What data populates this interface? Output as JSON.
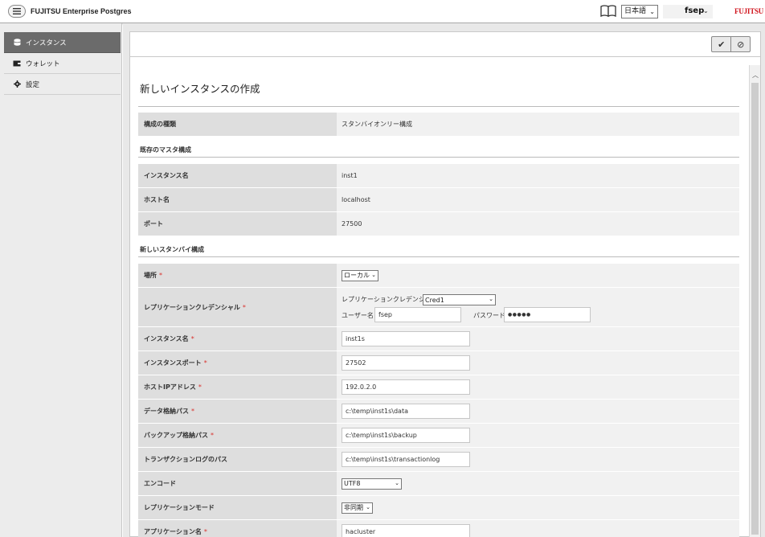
{
  "header": {
    "app_title": "FUJITSU Enterprise Postgres",
    "language": "日本語",
    "user": "fsep",
    "brand": "FUJITSU"
  },
  "sidebar": {
    "items": [
      {
        "label": "インスタンス",
        "icon": "database-icon",
        "active": true
      },
      {
        "label": "ウォレット",
        "icon": "wallet-icon",
        "active": false
      },
      {
        "label": "設定",
        "icon": "gear-icon",
        "active": false
      }
    ]
  },
  "toolbar": {
    "confirm_icon": "✔",
    "cancel_icon": "⊘"
  },
  "page": {
    "title": "新しいインスタンスの作成",
    "config_type_label": "構成の種類",
    "config_type_value": "スタンバイオンリー構成",
    "existing_master_section": "既存のマスタ構成",
    "existing": {
      "instance_name_label": "インスタンス名",
      "instance_name_value": "inst1",
      "host_label": "ホスト名",
      "host_value": "localhost",
      "port_label": "ポート",
      "port_value": "27500"
    },
    "new_standby_section": "新しいスタンバイ構成",
    "form": {
      "location_label": "場所",
      "location_value": "ローカル",
      "credential_label": "レプリケーションクレデンシャル",
      "credential_inline_label": "レプリケーションクレデンシャル",
      "credential_value": "Cred1",
      "username_label": "ユーザー名",
      "username_value": "fsep",
      "password_label": "パスワード",
      "password_value": "●●●●●",
      "instance_name_label": "インスタンス名",
      "instance_name_value": "inst1s",
      "instance_port_label": "インスタンスポート",
      "instance_port_value": "27502",
      "host_ip_label": "ホストIPアドレス",
      "host_ip_value": "192.0.2.0",
      "data_path_label": "データ格納パス",
      "data_path_value": "c:\\temp\\inst1s\\data",
      "backup_path_label": "バックアップ格納パス",
      "backup_path_value": "c:\\temp\\inst1s\\backup",
      "txlog_path_label": "トランザクションログのパス",
      "txlog_path_value": "c:\\temp\\inst1s\\transactionlog",
      "encoding_label": "エンコード",
      "encoding_value": "UTF8",
      "replication_mode_label": "レプリケーションモード",
      "replication_mode_value": "非同期",
      "app_name_label": "アプリケーション名",
      "app_name_value": "hacluster"
    },
    "required_mark": "*"
  }
}
